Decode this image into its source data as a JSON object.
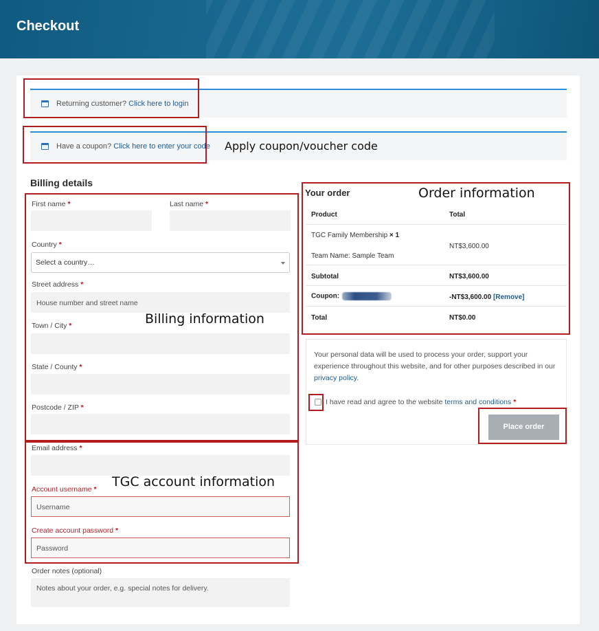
{
  "header": {
    "title": "Checkout"
  },
  "notices": {
    "returning": {
      "prefix": "Returning customer?",
      "link": "Click here to login"
    },
    "coupon": {
      "prefix": "Have a coupon?",
      "link": "Click here to enter your code"
    }
  },
  "billing": {
    "title": "Billing details",
    "first_name": "First name",
    "last_name": "Last name",
    "country": "Country",
    "country_select": "Select a country…",
    "street": "Street address",
    "street_placeholder": "House number and street name",
    "city": "Town / City",
    "state": "State / County",
    "postcode": "Postcode / ZIP",
    "email": "Email address",
    "username": "Account username",
    "username_placeholder": "Username",
    "password": "Create account password",
    "password_placeholder": "Password",
    "notes": "Order notes (optional)",
    "notes_placeholder": "Notes about your order, e.g. special notes for delivery.",
    "required_mark": "*"
  },
  "order": {
    "title": "Your order",
    "col_product": "Product",
    "col_total": "Total",
    "item_name": "TGC Family Membership",
    "item_qty": "× 1",
    "item_meta": "Team Name: Sample Team",
    "item_total": "NT$3,600.00",
    "subtotal_label": "Subtotal",
    "subtotal": "NT$3,600.00",
    "coupon_label": "Coupon:",
    "coupon_value": "-NT$3,600.00",
    "coupon_remove": "[Remove]",
    "total_label": "Total",
    "total": "NT$0.00"
  },
  "privacy": {
    "text": "Your personal data will be used to process your order, support your experience throughout this website, and for other purposes described in our",
    "link": "privacy policy",
    "end": ".",
    "terms_prefix": "I have read and agree to the website",
    "terms_link": "terms and conditions",
    "place_order": "Place order"
  },
  "annotations": {
    "coupon": "Apply coupon/voucher code",
    "order": "Order information",
    "billing": "Billing information",
    "account": "TGC account information"
  }
}
